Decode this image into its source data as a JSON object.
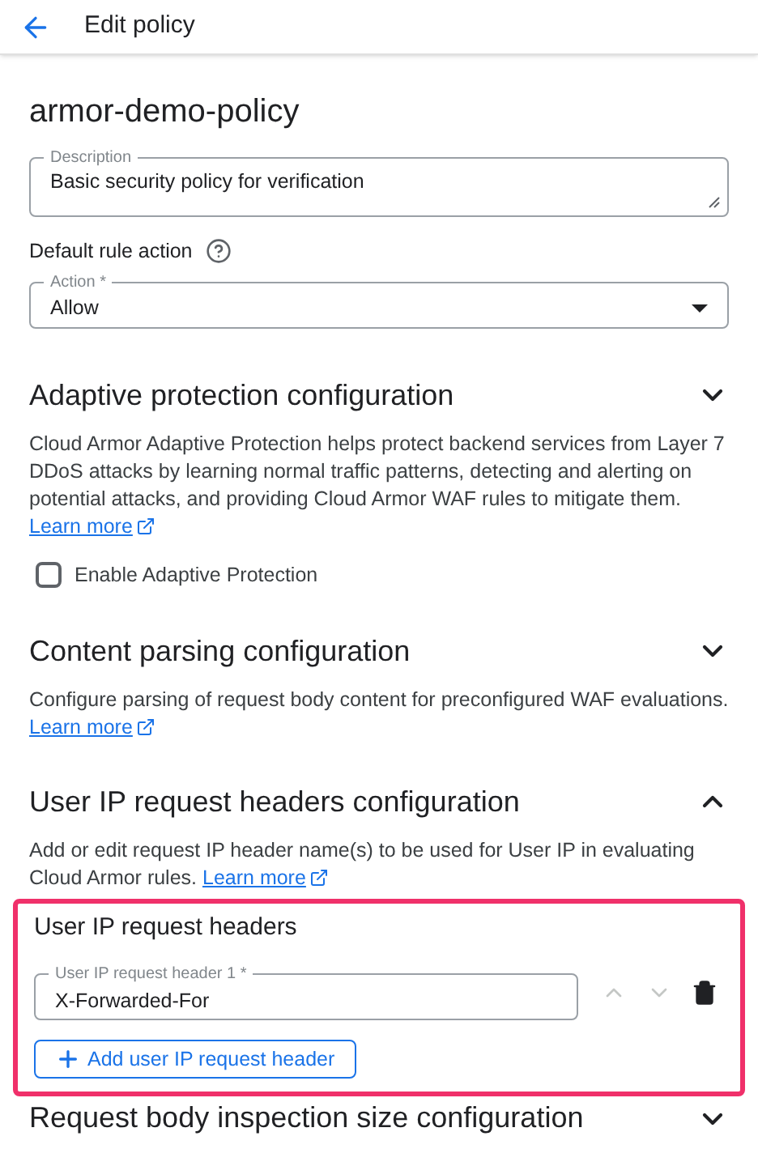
{
  "header": {
    "title": "Edit policy"
  },
  "policy_name": "armor-demo-policy",
  "description_field": {
    "label": "Description",
    "value": "Basic security policy for verification"
  },
  "default_rule": {
    "label": "Default rule action",
    "select": {
      "label": "Action *",
      "value": "Allow"
    }
  },
  "sections": [
    {
      "kind": "block",
      "title": "Adaptive protection configuration",
      "expanded": false,
      "description": "Cloud Armor Adaptive Protection helps protect backend services from Layer 7 DDoS attacks by learning normal traffic patterns, detecting and alerting on potential attacks, and providing Cloud Armor WAF rules to mitigate them.",
      "link": "Learn more",
      "checkbox": {
        "label": "Enable Adaptive Protection",
        "checked": false
      }
    },
    {
      "kind": "block",
      "title": "Content parsing configuration",
      "expanded": false,
      "description": "Configure parsing of request body content for preconfigured WAF evaluations.",
      "link": "Learn more"
    },
    {
      "kind": "inline",
      "title": "User IP request headers configuration",
      "expanded": true,
      "description": "Add or edit request IP header name(s) to be used for User IP in evaluating Cloud Armor rules.",
      "link": "Learn more"
    }
  ],
  "headers_panel": {
    "title": "User IP request headers",
    "highlighted": true,
    "fields": [
      {
        "label": "User IP request header 1 *",
        "value": "X-Forwarded-For",
        "move_up_disabled": true,
        "move_down_disabled": true
      }
    ],
    "add_button": "Add user IP request header"
  },
  "next_section": {
    "title": "Request body inspection size configuration",
    "expanded": false
  }
}
